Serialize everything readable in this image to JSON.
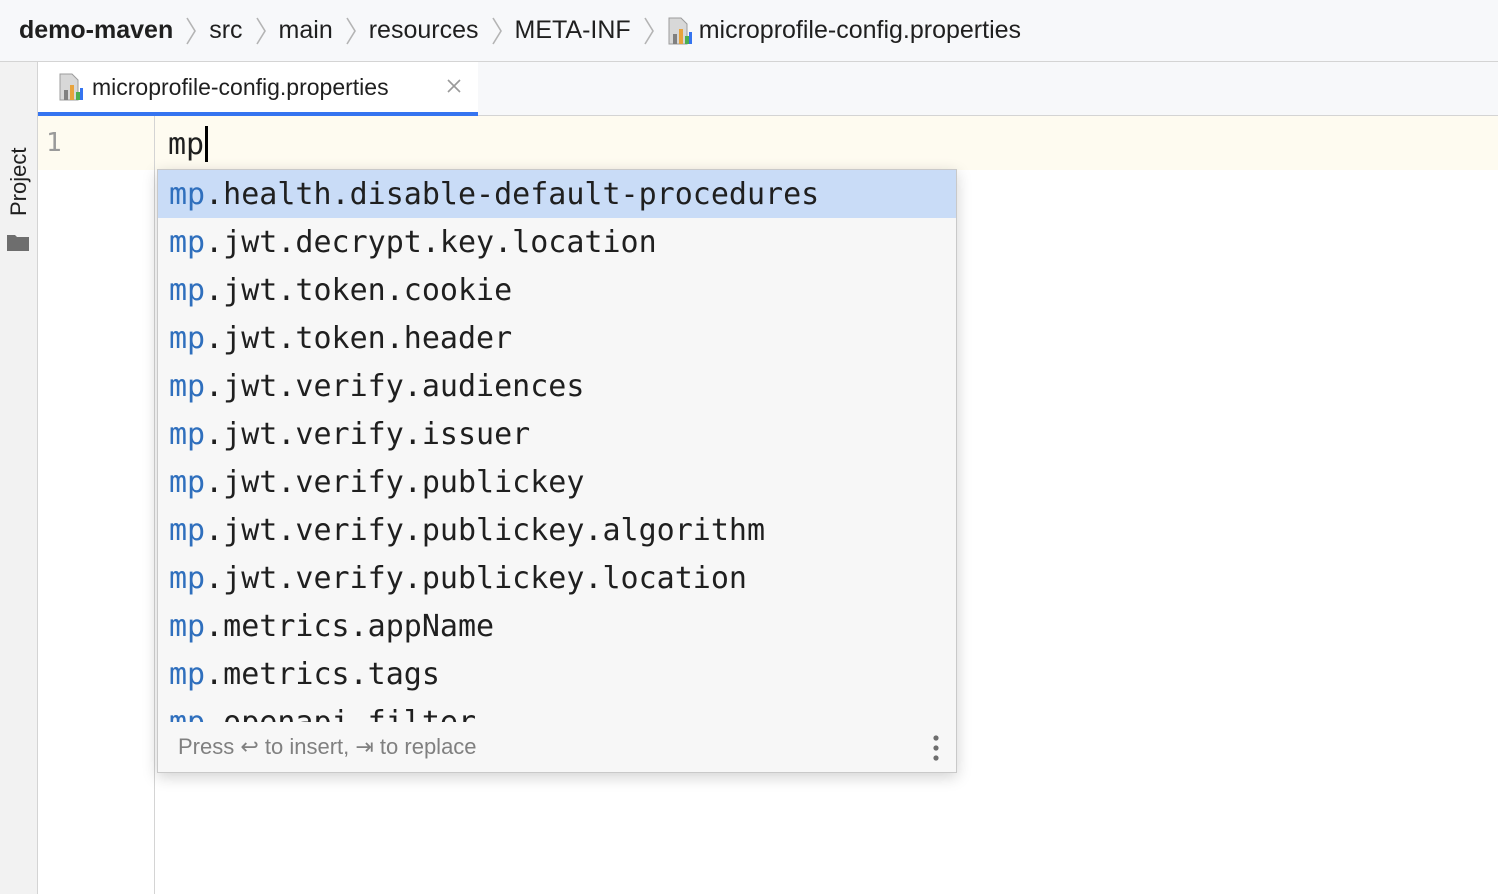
{
  "breadcrumb": {
    "items": [
      "demo-maven",
      "src",
      "main",
      "resources",
      "META-INF"
    ],
    "file": "microprofile-config.properties"
  },
  "toolwindow": {
    "project_label": "Project"
  },
  "tab": {
    "label": "microprofile-config.properties"
  },
  "editor": {
    "line_number": "1",
    "text": "mp"
  },
  "completion": {
    "match_prefix": "mp",
    "items": [
      {
        "prefix": "mp",
        "rest": ".health.disable-default-procedures",
        "selected": true
      },
      {
        "prefix": "mp",
        "rest": ".jwt.decrypt.key.location"
      },
      {
        "prefix": "mp",
        "rest": ".jwt.token.cookie"
      },
      {
        "prefix": "mp",
        "rest": ".jwt.token.header"
      },
      {
        "prefix": "mp",
        "rest": ".jwt.verify.audiences"
      },
      {
        "prefix": "mp",
        "rest": ".jwt.verify.issuer"
      },
      {
        "prefix": "mp",
        "rest": ".jwt.verify.publickey"
      },
      {
        "prefix": "mp",
        "rest": ".jwt.verify.publickey.algorithm"
      },
      {
        "prefix": "mp",
        "rest": ".jwt.verify.publickey.location"
      },
      {
        "prefix": "mp",
        "rest": ".metrics.appName"
      },
      {
        "prefix": "mp",
        "rest": ".metrics.tags"
      },
      {
        "prefix": "mp",
        "rest": ".openapi.filter"
      }
    ],
    "footer": "Press ↩ to insert, ⇥ to replace"
  },
  "colors": {
    "accent": "#3574f0",
    "match": "#2f6fbd",
    "selection": "#c9dcf7",
    "current_line": "#fefbf0"
  },
  "icons": {
    "file": "properties-file-icon",
    "close": "close-icon",
    "more": "more-vertical-icon",
    "folder": "folder-icon"
  }
}
